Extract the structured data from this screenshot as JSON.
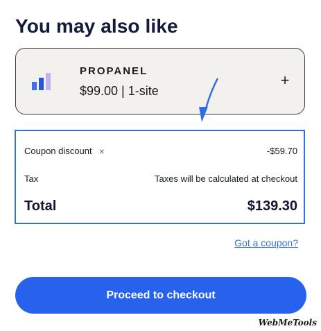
{
  "heading": "You may also like",
  "upsell": {
    "product_name": "PROPANEL",
    "price_line": "$99.00 | 1-site",
    "add_label": "+",
    "icon": "bar-chart-icon",
    "icon_colors": [
      "#3f6fe6",
      "#2b57d6",
      "#c5b1f2"
    ]
  },
  "summary": {
    "coupon_label": "Coupon discount",
    "coupon_remove": "×",
    "coupon_value": "-$59.70",
    "tax_label": "Tax",
    "tax_value": "Taxes will be calculated at checkout",
    "total_label": "Total",
    "total_value": "$139.30"
  },
  "coupon_link": "Got a coupon?",
  "checkout_label": "Proceed to checkout",
  "watermark": "WebMeTools",
  "colors": {
    "accent": "#2762ec",
    "highlight_border": "#2f6fe0",
    "link": "#3870d6"
  }
}
